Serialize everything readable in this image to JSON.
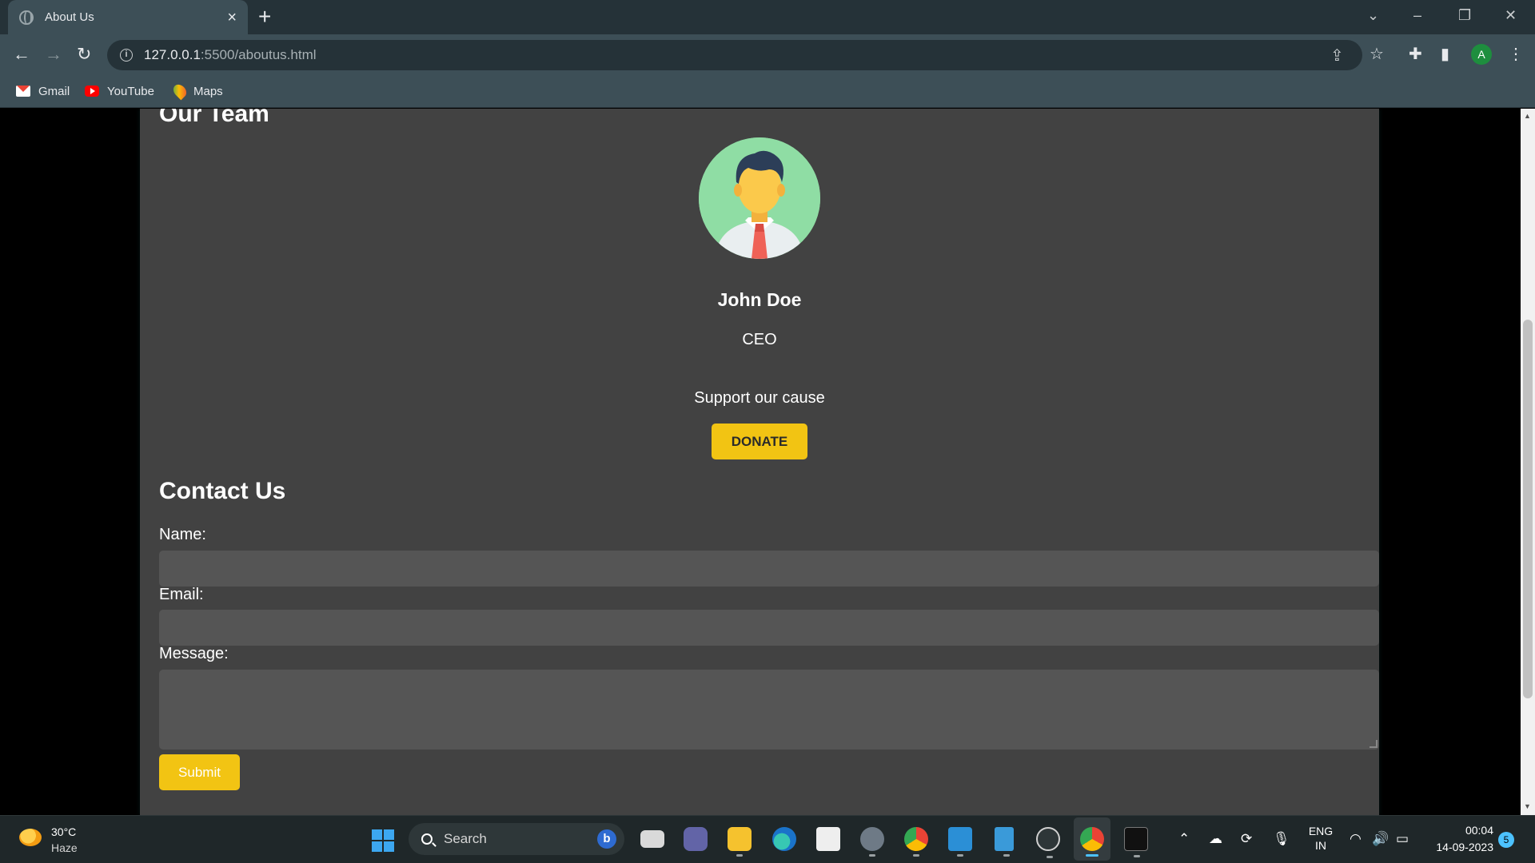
{
  "browser": {
    "tab_title": "About Us",
    "url_host": "127.0.0.1",
    "url_path": ":5500/aboutus.html",
    "profile_initial": "A",
    "bookmarks": [
      {
        "label": "Gmail",
        "icon": "gmail-icon"
      },
      {
        "label": "YouTube",
        "icon": "youtube-icon"
      },
      {
        "label": "Maps",
        "icon": "maps-icon"
      }
    ]
  },
  "page": {
    "team_heading": "Our Team",
    "member": {
      "name": "John Doe",
      "role": "CEO"
    },
    "support_text": "Support our cause",
    "donate_label": "DONATE",
    "contact_heading": "Contact Us",
    "form": {
      "name_label": "Name:",
      "email_label": "Email:",
      "message_label": "Message:",
      "name_value": "",
      "email_value": "",
      "message_value": "",
      "submit_label": "Submit"
    }
  },
  "taskbar": {
    "weather_temp": "30°C",
    "weather_desc": "Haze",
    "search_label": "Search",
    "language_line1": "ENG",
    "language_line2": "IN",
    "clock_time": "00:04",
    "clock_date": "14-09-2023",
    "notification_count": "5"
  },
  "colors": {
    "accent_yellow": "#f2c413",
    "page_background": "#424242",
    "browser_chrome": "#3d4f57"
  }
}
